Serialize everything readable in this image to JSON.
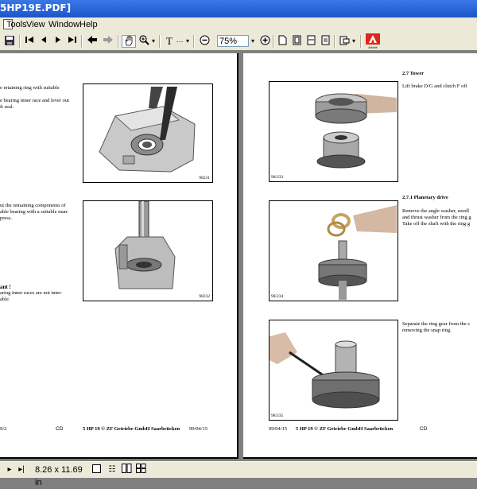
{
  "window": {
    "title": "5HP19E.PDF]"
  },
  "menu": {
    "items": [
      "Tools",
      "View",
      "Window",
      "Help"
    ]
  },
  "toolbar": {
    "zoom": "75%"
  },
  "left_page": {
    "para1": [
      "e retaining ring with suitable"
    ],
    "para2": [
      "e bearing  inner race and lever out",
      "ft seal."
    ],
    "fig1_num": "98231",
    "para3": [
      "ut the remaining components of",
      "able bearing with a suitable man-",
      "press."
    ],
    "fig2_num": "98232",
    "note_title": "ant !",
    "note_lines": [
      "aring inner races are not inter-",
      "able."
    ],
    "footer_left": "9/2",
    "footer_cd": "CD",
    "footer_center": "5 HP 19 © ZF Getriebe GmbH Saarbrücken",
    "footer_date": "99/04/15"
  },
  "right_page": {
    "h1": "2.7    Tower",
    "t1": [
      "Lift brake D/G and clutch F off"
    ],
    "fig1_num": "98/233",
    "h2": "2.7.1    Planetary drive",
    "t2": [
      "Remove the angle washer, needl",
      "and thrust washer from the ring g",
      "Take off the shaft with the ring g"
    ],
    "fig2_num": "98/234",
    "t3": [
      "Separate the ring gear from the s",
      "removing the snap ring."
    ],
    "fig3_num": "98/235",
    "footer_date": "99/04/15",
    "footer_center": "5 HP 19 © ZF Getriebe GmbH Saarbrücken",
    "footer_cd": "CD"
  },
  "status": {
    "page_size": "8.26 x 11.69 in"
  }
}
